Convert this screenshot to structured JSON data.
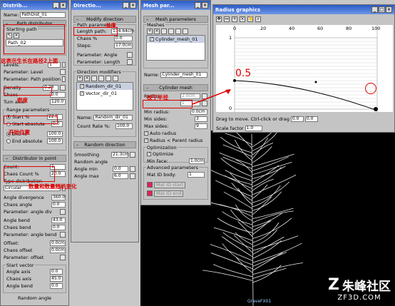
{
  "distributor": {
    "title": "Distrib...",
    "name_label": "Name:",
    "name_value": "PathDist_01",
    "section_path": "Path distributor",
    "starting_path": "Starting path",
    "path_list": [
      "Path_02"
    ],
    "levels_label": "Levels:",
    "levels_value": "1",
    "param_level": "Parameter: Level",
    "param_position": "Parameter: Path position",
    "density_label": "Density",
    "density_value": "0.28",
    "chaos_label": "Chaos",
    "chaos_value": "0.0",
    "turn_label": "Turn axis:",
    "turn_value": "120.0",
    "range_label": "Range parameters",
    "start_label": "Start %",
    "start_value": "22.0",
    "start_abs": "Start absolute",
    "start_abs_value": "0.0",
    "end_label": "End %",
    "end_value": "100.0",
    "end_abs": "End absolute",
    "end_abs_value": "100.0",
    "section_point": "Distributor in point",
    "count_label": "Count:",
    "count_value": "1",
    "chaos_count_label": "Chaos Count %",
    "chaos_count_value": "20.0",
    "type_label": "Type distribution",
    "type_value": "Circular",
    "angle_div_label": "Angle divergence",
    "angle_div_value": "360.0",
    "chaos_angle_label": "Chaos angle",
    "chaos_angle_value": "0.0",
    "param_angle_div": "Parameter: angle div",
    "angle_bend_label": "Angle bend",
    "angle_bend_value": "43.0",
    "chaos_bend_label": "Chaos bend",
    "chaos_bend_value": "0.0",
    "param_angle_bend": "Parameter: angle bend",
    "offset_label": "Offset:",
    "offset_value": "0.0cm",
    "chaos_offset_label": "Chaos offset",
    "chaos_offset_value": "0.0cm",
    "param_offset": "Parameter: offset",
    "start_vector": "Start vector",
    "angle_axis_label": "Angle axis",
    "angle_axis_value": "0.0",
    "chaos_axis_label": "Chaos axis",
    "chaos_axis_value": "45.0",
    "angle_bend2_label": "Angle bend",
    "angle_bend2_value": "0.0",
    "random_angle": "Random angle"
  },
  "direction": {
    "title": "Directio...",
    "section_modify": "Modify direction",
    "section_path_params": "Path parameters",
    "length_label": "Length path:",
    "length_value": "134.64cm",
    "chaos_label": "Chaos %",
    "chaos_value": "0.0",
    "steps_label": "Steps:",
    "steps_value": "17.0cm",
    "param_angle": "Parameter: Angle",
    "param_length": "Parameter: Length",
    "section_modifiers": "Direction modifiers",
    "modifiers": [
      "Random_dir_01",
      "Vector_dir_01"
    ],
    "name_label": "Name:",
    "name_value": "Random_dir_01",
    "count_rate_label": "Count Rate %:",
    "count_rate_value": "100.0",
    "section_random": "Random direction",
    "smoothing_label": "Smoothing",
    "smoothing_value": "21.3cm",
    "random_angle": "Random angle",
    "angle_min_label": "Angle min",
    "angle_min_value": "0.0",
    "angle_max_label": "Angle max",
    "angle_max_value": "6.0"
  },
  "mesh": {
    "title": "Mesh par...",
    "section_params": "Mesh parameters",
    "meshes_label": "Meshes",
    "mesh_list": [
      "Cylinder_mesh_01"
    ],
    "name_label": "Name:",
    "name_value": "Cylinder_mesh_01",
    "section_cyl": "Cylinder mesh",
    "radius_label": "Radius:",
    "radius_value": "2.0cm",
    "field2_value": "1",
    "min_radius_label": "Min radius:",
    "min_radius_value": "0.0cm",
    "min_sides_label": "Min sides:",
    "min_sides_value": "3",
    "max_sides_label": "Max sides:",
    "max_sides_value": "9",
    "auto_radius": "Auto radius",
    "radius_parent": "Radius < Parent radius",
    "optimization": "Optimization",
    "optimize": "Optimize",
    "min_face_label": "Min face:",
    "min_face_value": "1.0cm",
    "advanced": "Advanced parameters",
    "mat_id_label": "Mat ID body:",
    "mat_id_value": "1",
    "mat_id_start": "Mat ID start",
    "mat_id_end": "Mat ID end"
  },
  "radius": {
    "title": "Radius graphics",
    "ticks": [
      "0",
      "20",
      "40",
      "60",
      "80",
      "100"
    ],
    "y_top": "1",
    "y_bottom": "0",
    "status": "Drag to move. Ctrl-click or drag",
    "status_value": "0.0",
    "status_value2": "0.0",
    "scale_label": "Scale factor",
    "scale_value": "1.0"
  },
  "annotations": {
    "length": "长度",
    "start_growth": "这表示生长在路径2上面",
    "density": "密度",
    "start_pos": "开始位置",
    "count_change": "数量和数量随机变化",
    "trunk_radius": "枝干半径",
    "value_05": "0.5"
  },
  "viewport_label": "GraveFX01",
  "watermark": {
    "brand": "朱峰社区",
    "url": "ZF3D.COM"
  },
  "colors": {
    "title_blue": "#2a5cc7",
    "annotation_red": "#e00000",
    "panel": "#c4c4c4"
  }
}
